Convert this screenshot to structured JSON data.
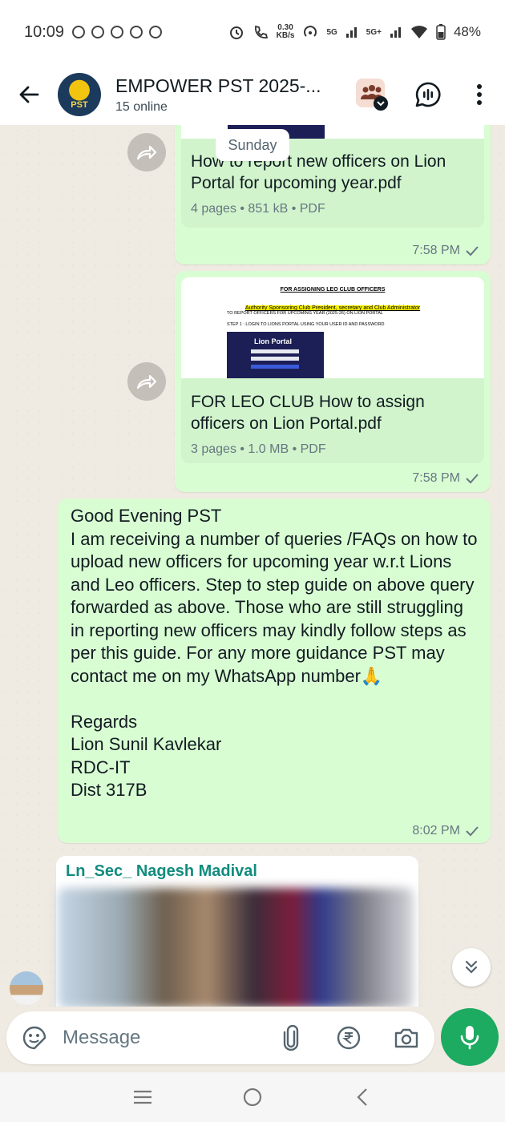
{
  "status": {
    "time": "10:09",
    "speed_value": "0.30",
    "speed_unit": "KB/s",
    "net1": "5G",
    "net2": "5G+",
    "battery": "48%"
  },
  "header": {
    "avatar_text": "PST",
    "title": "EMPOWER PST 2025-...",
    "subtitle": "15 online"
  },
  "chat": {
    "date_chip": "Sunday",
    "doc1": {
      "name": "How to report new officers on Lion Portal for upcoming year.pdf",
      "meta": "4 pages • 851 kB • PDF",
      "time": "7:58 PM"
    },
    "doc2": {
      "preview_title": "FOR ASSIGNING LEO CLUB OFFICERS",
      "preview_highlight": "Authority Sponsoring Club President, secretary and Club Administrator",
      "preview_line1": "TO REPORT OFFICERS FOR UPCOMING YEAR (2025-26) ON LION PORTAL",
      "preview_line2": "STEP 1 : LOGIN TO LIONS PORTAL USING YOUR USER ID AND PASSWORD",
      "preview_brand": "Lion Portal",
      "name": "FOR LEO CLUB How to assign officers on Lion Portal.pdf",
      "meta": "3 pages • 1.0 MB • PDF",
      "time": "7:58 PM"
    },
    "text_msg": {
      "body": "Good Evening PST\nI am receiving a number of queries /FAQs on how to upload new officers for upcoming year w.r.t Lions and Leo officers. Step to step guide on above query forwarded as above. Those who are still struggling in reporting new officers may kindly follow steps as per this guide. For any more guidance PST may contact me on my WhatsApp number🙏\n\nRegards\nLion Sunil Kavlekar\nRDC-IT\nDist 317B",
      "time": "8:02 PM"
    },
    "incoming": {
      "sender": "Ln_Sec_ Nagesh Madival"
    }
  },
  "composer": {
    "placeholder": "Message"
  },
  "colors": {
    "outgoing_bubble": "#d9fdd3",
    "accent_green": "#1daa61",
    "sender_name": "#128c7e"
  }
}
